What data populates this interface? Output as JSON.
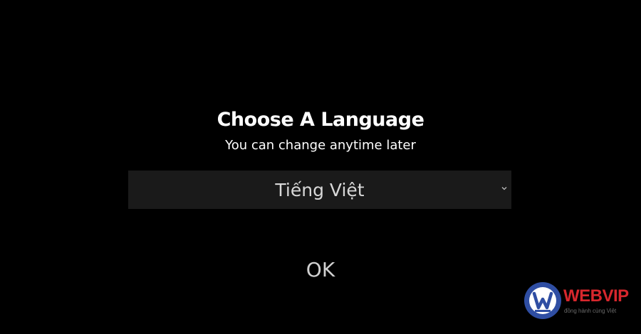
{
  "dialog": {
    "title": "Choose A Language",
    "subtitle": "You can change anytime later",
    "language_select": {
      "selected": "Tiếng Việt",
      "chevron_icon": "chevron-down-icon"
    },
    "ok_label": "OK"
  },
  "watermark": {
    "brand": "WEBVIP",
    "tagline": "đồng hành cùng Việt",
    "logo_icon": "webvip-logo-icon"
  },
  "colors": {
    "background": "#000000",
    "select_background": "#1a1a1a",
    "text": "#ffffff",
    "brand_red": "#d7272d",
    "brand_blue": "#2f4ea3"
  }
}
